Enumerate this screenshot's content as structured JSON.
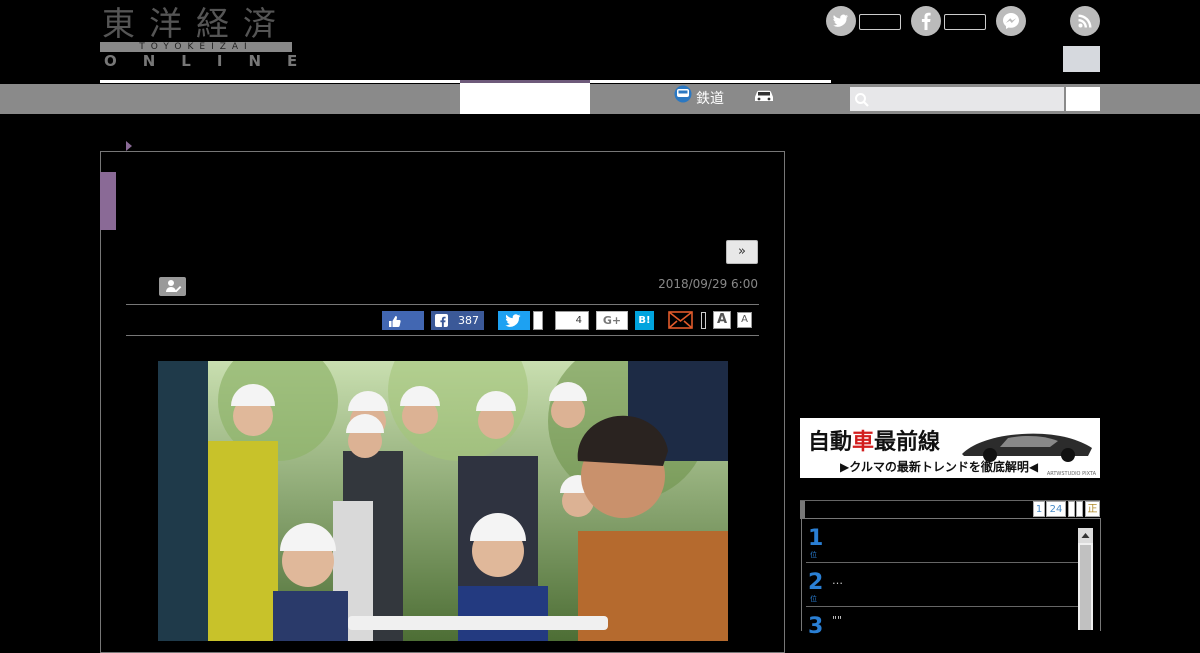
{
  "header": {
    "logo_kanji": "東洋経済",
    "logo_band": "TOYOKEIZAI",
    "logo_online": "ONLINE",
    "social": [
      {
        "icon": "twitter-icon"
      },
      {
        "icon": "facebook-icon"
      },
      {
        "icon": "messenger-icon"
      },
      {
        "icon": "rss-icon"
      }
    ]
  },
  "nav": {
    "items": [
      {
        "label": "鉄道",
        "icon": "train-icon"
      },
      {
        "label": "",
        "icon": "car-icon"
      }
    ],
    "search": {
      "placeholder": ""
    }
  },
  "article": {
    "next_label": "»",
    "date": "2018/09/29 6:00",
    "share": {
      "facebook_count": "387",
      "pocket_count": "4",
      "gplus_label": "G+",
      "hatena_label": "B!",
      "font_large": "A",
      "font_small": "A"
    }
  },
  "sidebar": {
    "banner": {
      "title_a": "自動",
      "title_b": "車",
      "title_c": "最前線",
      "subtitle": "▶クルマの最新トレンドを徹底解明◀",
      "credit": "ARTWSTUDIO PIXTA"
    },
    "ranking_pages": [
      "1",
      "24",
      "",
      "",
      "正"
    ],
    "ranking": [
      {
        "rank": "1",
        "unit": "位",
        "title": ""
      },
      {
        "rank": "2",
        "unit": "位",
        "title": "…"
      },
      {
        "rank": "3",
        "unit": "位",
        "title": "\"\""
      }
    ]
  },
  "colors": {
    "accent_purple": "#8a6a96",
    "nav_gray": "#8a8a8a",
    "facebook_blue": "#3b5998",
    "twitter_blue": "#1da1f2",
    "hatena_blue": "#00a4de",
    "rank_blue": "#2a7fd4"
  }
}
